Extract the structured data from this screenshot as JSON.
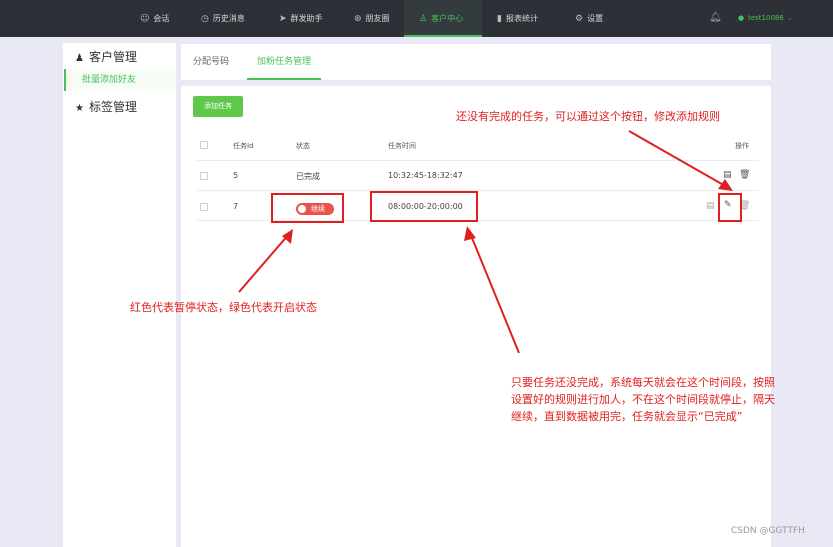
{
  "nav": {
    "items": [
      {
        "label": "会话",
        "icon": "chat-icon"
      },
      {
        "label": "历史消息",
        "icon": "clock-icon"
      },
      {
        "label": "群发助手",
        "icon": "send-icon"
      },
      {
        "label": "朋友圈",
        "icon": "moments-icon"
      },
      {
        "label": "客户中心",
        "icon": "user-icon",
        "active": true
      },
      {
        "label": "报表统计",
        "icon": "bar-chart-icon"
      },
      {
        "label": "设置",
        "icon": "gear-icon"
      }
    ],
    "user": "test10086",
    "accent": "#4bc05a"
  },
  "sidebar": {
    "customer_management": "客户管理",
    "batch_add_friends": "批量添加好友",
    "tag_management": "标签管理"
  },
  "tabs": [
    {
      "label": "分配号码"
    },
    {
      "label": "加粉任务管理",
      "active": true
    }
  ],
  "toolbar": {
    "add_task": "添加任务"
  },
  "table": {
    "headers": {
      "id": "任务Id",
      "status": "状态",
      "time": "任务时间",
      "ops": "操作"
    },
    "rows": [
      {
        "id": "5",
        "status": "已完成",
        "time": "10:32:45-18:32:47"
      },
      {
        "id": "7",
        "status": "继续",
        "time": "08:00:00-20:00:00",
        "toggle_color": "#e9524d"
      }
    ]
  },
  "annotations": {
    "edit_note": "还没有完成的任务，可以通过这个按钮，修改添加规则",
    "status_note": "红色代表暂停状态，绿色代表开启状态",
    "time_note_line1": "只要任务还没完成，系统每天就会在这个时间段，按照",
    "time_note_line2": "设置好的规则进行加人，不在这个时间段就停止，隔天",
    "time_note_line3": "继续，直到数据被用完，任务就会显示“已完成”",
    "color": "#e02020"
  },
  "watermark": "CSDN @GGTTFH"
}
